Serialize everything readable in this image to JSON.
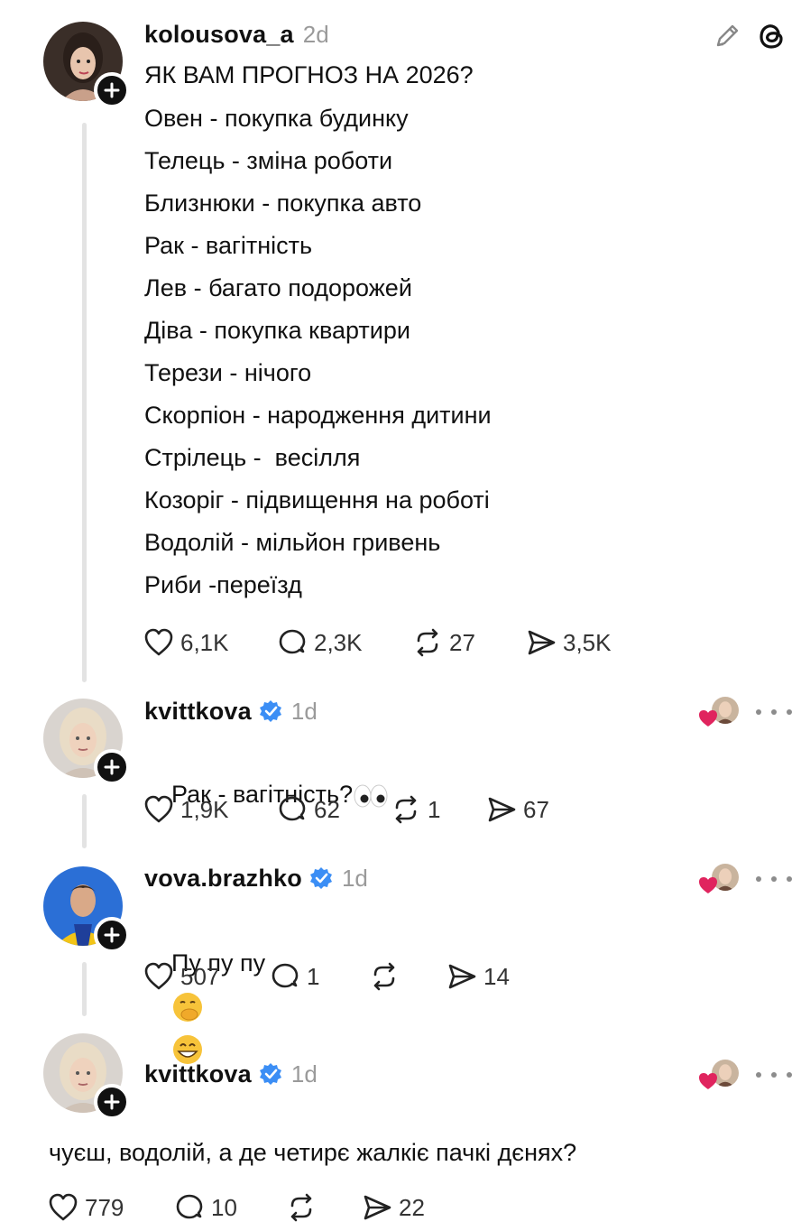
{
  "post": {
    "username": "kolousova_a",
    "time": "2d",
    "title": "ЯК ВАМ ПРОГНОЗ НА 2026?",
    "lines": [
      "Овен - покупка будинку",
      "Телець - зміна роботи",
      "Близнюки - покупка авто",
      "Рак - вагітність",
      "Лев - багато подорожей",
      "Діва - покупка квартири",
      "Терези - нічого",
      "Скорпіон - народження дитини",
      "Стрілець -  весілля",
      "Козоріг - підвищення на роботі",
      "Водолій - мільйон гривень",
      "Риби -переїзд"
    ],
    "likes": "6,1K",
    "replies": "2,3K",
    "reposts": "27",
    "shares": "3,5K"
  },
  "replies": [
    {
      "username": "kvittkova",
      "time": "1d",
      "text": "Рак - вагітність?",
      "emoji": "eyes",
      "likes": "1,9K",
      "replies": "62",
      "reposts": "1",
      "shares": "67"
    },
    {
      "username": "vova.brazhko",
      "time": "1d",
      "text": "Пу пу пу",
      "emoji": "hand-over-mouth, grinning-face",
      "likes": "507",
      "replies": "1",
      "reposts": "",
      "shares": "14"
    },
    {
      "username": "kvittkova",
      "time": "1d",
      "text": "чуєш, водолій, а де четирє жалкіє пачкі дєнях?",
      "likes": "779",
      "replies": "10",
      "reposts": "",
      "shares": "22"
    }
  ],
  "colors": {
    "verified": "#3b8ef5",
    "like_heart": "#e0245e",
    "muted": "#9a9a9a"
  },
  "icons": [
    "edit-pencil-icon",
    "threads-logo-icon",
    "heart-icon",
    "comment-icon",
    "repost-icon",
    "share-icon",
    "verified-icon",
    "follow-plus-icon",
    "more-icon"
  ]
}
